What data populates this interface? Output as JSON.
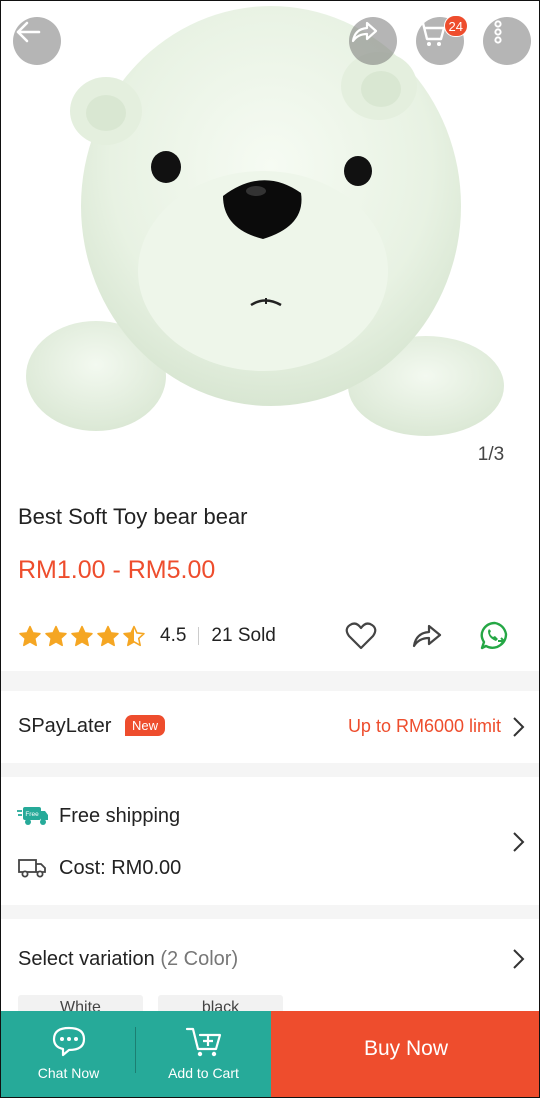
{
  "header": {
    "cart_badge": "24"
  },
  "gallery": {
    "pager": "1/3"
  },
  "product": {
    "title": "Best Soft Toy bear bear",
    "price": "RM1.00 - RM5.00",
    "rating_value": "4.5",
    "rating_stars": 4.5,
    "sold": "21 Sold"
  },
  "spaylater": {
    "label": "SPayLater",
    "badge": "New",
    "limit": "Up to RM6000 limit"
  },
  "shipping": {
    "free_badge": "Free",
    "free_label": "Free shipping",
    "cost_label": "Cost: RM0.00"
  },
  "variation": {
    "label": "Select variation",
    "count": "(2 Color)",
    "options": [
      "White",
      "black"
    ]
  },
  "bottom_bar": {
    "chat_label": "Chat Now",
    "cart_label": "Add to Cart",
    "buy_label": "Buy Now"
  },
  "colors": {
    "accent": "#ee4d2d",
    "teal": "#26aa99",
    "star": "#f5a623",
    "whatsapp": "#25a745"
  }
}
